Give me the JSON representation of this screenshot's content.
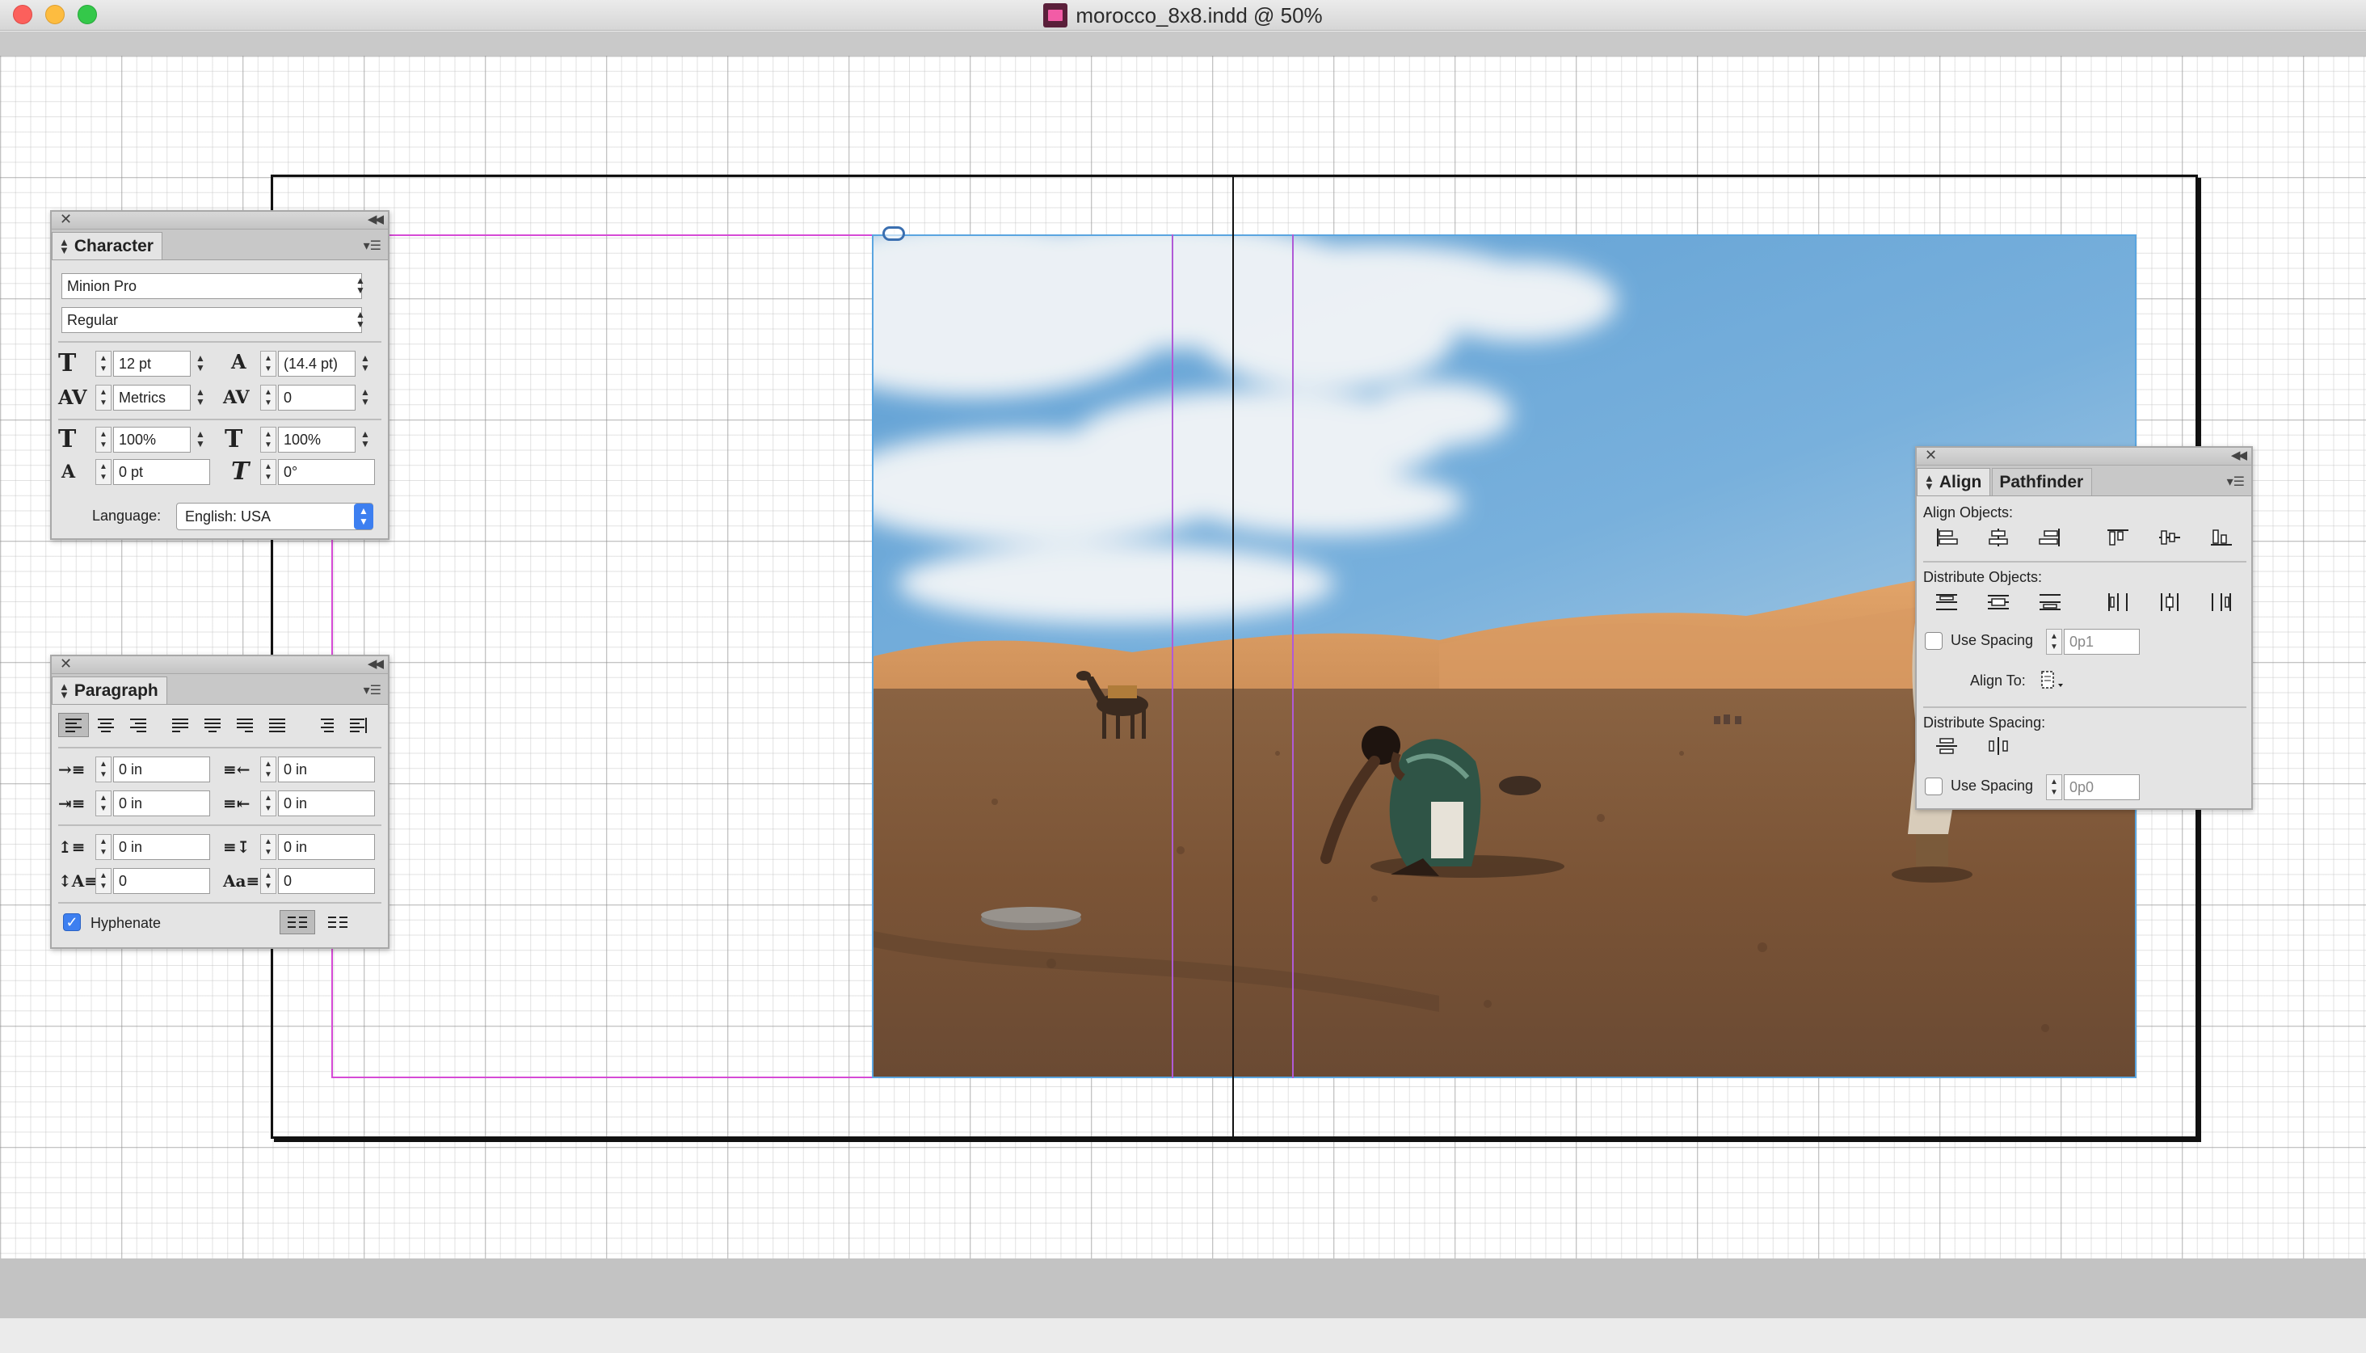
{
  "window": {
    "title": "morocco_8x8.indd @ 50%",
    "buttons": [
      "close",
      "minimize",
      "zoom"
    ]
  },
  "character_panel": {
    "tab_label": "Character",
    "font_family": "Minion Pro",
    "font_style": "Regular",
    "size": "12 pt",
    "leading": "(14.4 pt)",
    "kerning": "Metrics",
    "tracking": "0",
    "vertical_scale": "100%",
    "horizontal_scale": "100%",
    "baseline_shift": "0 pt",
    "skew": "0°",
    "language_label": "Language:",
    "language": "English: USA"
  },
  "paragraph_panel": {
    "tab_label": "Paragraph",
    "left_indent": "0 in",
    "right_indent": "0 in",
    "first_line_indent": "0 in",
    "last_line_indent": "0 in",
    "space_before": "0 in",
    "space_after": "0 in",
    "drop_cap_lines": "0",
    "drop_cap_chars": "0",
    "hyphenate_label": "Hyphenate",
    "hyphenate_checked": true
  },
  "align_panel": {
    "tab_align": "Align",
    "tab_pathfinder": "Pathfinder",
    "align_objects_label": "Align Objects:",
    "distribute_objects_label": "Distribute Objects:",
    "use_spacing_label": "Use Spacing",
    "objects_spacing": "0p1",
    "align_to_label": "Align To:",
    "distribute_spacing_label": "Distribute Spacing:",
    "spacing_value": "0p0"
  },
  "colors": {
    "margin_guide": "#d64ad6",
    "column_guide": "#b05ad6",
    "frame_edge": "#5aa5e0",
    "accent_blue": "#3d7ff0"
  }
}
